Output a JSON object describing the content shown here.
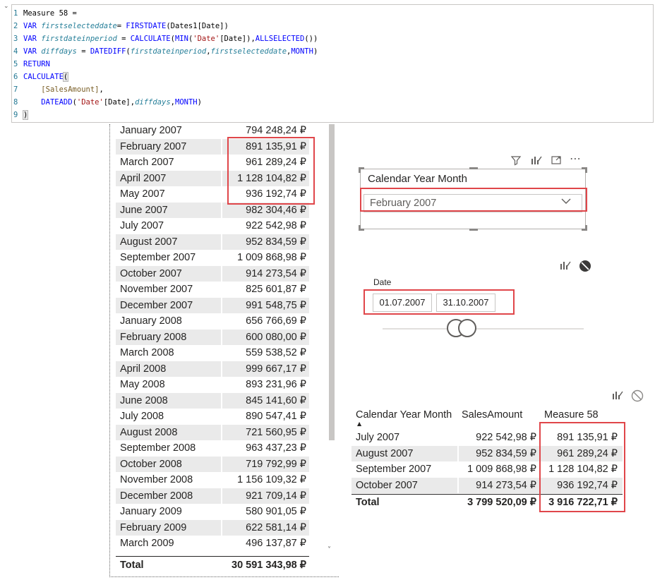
{
  "editor": {
    "line_number_prefix": "1",
    "lines": [
      {
        "num": "1",
        "tokens": [
          {
            "t": "Measure 58 =",
            "c": "plain"
          }
        ]
      },
      {
        "num": "2",
        "tokens": [
          {
            "t": "VAR ",
            "c": "kw"
          },
          {
            "t": "firstselecteddate",
            "c": "var"
          },
          {
            "t": "= ",
            "c": "plain"
          },
          {
            "t": "FIRSTDATE",
            "c": "fn"
          },
          {
            "t": "(Dates1[Date])",
            "c": "plain"
          }
        ]
      },
      {
        "num": "3",
        "tokens": [
          {
            "t": "VAR ",
            "c": "kw"
          },
          {
            "t": "firstdateinperiod",
            "c": "var"
          },
          {
            "t": " = ",
            "c": "plain"
          },
          {
            "t": "CALCULATE",
            "c": "fn"
          },
          {
            "t": "(",
            "c": "plain"
          },
          {
            "t": "MIN",
            "c": "fn"
          },
          {
            "t": "(",
            "c": "plain"
          },
          {
            "t": "'Date'",
            "c": "str"
          },
          {
            "t": "[Date]),",
            "c": "plain"
          },
          {
            "t": "ALLSELECTED",
            "c": "fn"
          },
          {
            "t": "())",
            "c": "plain"
          }
        ]
      },
      {
        "num": "4",
        "tokens": [
          {
            "t": "VAR ",
            "c": "kw"
          },
          {
            "t": "diffdays",
            "c": "var"
          },
          {
            "t": " = ",
            "c": "plain"
          },
          {
            "t": "DATEDIFF",
            "c": "fn"
          },
          {
            "t": "(",
            "c": "plain"
          },
          {
            "t": "firstdateinperiod",
            "c": "var"
          },
          {
            "t": ",",
            "c": "plain"
          },
          {
            "t": "firstselecteddate",
            "c": "var"
          },
          {
            "t": ",",
            "c": "plain"
          },
          {
            "t": "MONTH",
            "c": "kw"
          },
          {
            "t": ")",
            "c": "plain"
          }
        ]
      },
      {
        "num": "5",
        "tokens": [
          {
            "t": "RETURN",
            "c": "kw"
          }
        ]
      },
      {
        "num": "6",
        "tokens": [
          {
            "t": "CALCULATE",
            "c": "fn"
          },
          {
            "t": "(",
            "c": "paren"
          }
        ]
      },
      {
        "num": "7",
        "tokens": [
          {
            "t": "    ",
            "c": "plain"
          },
          {
            "t": "[SalesAmount]",
            "c": "meas"
          },
          {
            "t": ",",
            "c": "plain"
          }
        ]
      },
      {
        "num": "8",
        "tokens": [
          {
            "t": "    ",
            "c": "plain"
          },
          {
            "t": "DATEADD",
            "c": "fn"
          },
          {
            "t": "(",
            "c": "plain"
          },
          {
            "t": "'Date'",
            "c": "str"
          },
          {
            "t": "[Date],",
            "c": "plain"
          },
          {
            "t": "diffdays",
            "c": "var"
          },
          {
            "t": ",",
            "c": "plain"
          },
          {
            "t": "MONTH",
            "c": "kw"
          },
          {
            "t": ")",
            "c": "plain"
          }
        ]
      },
      {
        "num": "9",
        "tokens": [
          {
            "t": ")",
            "c": "paren"
          }
        ]
      }
    ]
  },
  "left_table": {
    "rows": [
      [
        "January 2007",
        "794 248,24 ₽"
      ],
      [
        "February 2007",
        "891 135,91 ₽"
      ],
      [
        "March 2007",
        "961 289,24 ₽"
      ],
      [
        "April 2007",
        "1 128 104,82 ₽"
      ],
      [
        "May 2007",
        "936 192,74 ₽"
      ],
      [
        "June 2007",
        "982 304,46 ₽"
      ],
      [
        "July 2007",
        "922 542,98 ₽"
      ],
      [
        "August 2007",
        "952 834,59 ₽"
      ],
      [
        "September 2007",
        "1 009 868,98 ₽"
      ],
      [
        "October 2007",
        "914 273,54 ₽"
      ],
      [
        "November 2007",
        "825 601,87 ₽"
      ],
      [
        "December 2007",
        "991 548,75 ₽"
      ],
      [
        "January 2008",
        "656 766,69 ₽"
      ],
      [
        "February 2008",
        "600 080,00 ₽"
      ],
      [
        "March 2008",
        "559 538,52 ₽"
      ],
      [
        "April 2008",
        "999 667,17 ₽"
      ],
      [
        "May 2008",
        "893 231,96 ₽"
      ],
      [
        "June 2008",
        "845 141,60 ₽"
      ],
      [
        "July 2008",
        "890 547,41 ₽"
      ],
      [
        "August 2008",
        "721 560,95 ₽"
      ],
      [
        "September 2008",
        "963 437,23 ₽"
      ],
      [
        "October 2008",
        "719 792,99 ₽"
      ],
      [
        "November 2008",
        "1 156 109,32 ₽"
      ],
      [
        "December 2008",
        "921 709,14 ₽"
      ],
      [
        "January 2009",
        "580 901,05 ₽"
      ],
      [
        "February 2009",
        "622 581,14 ₽"
      ],
      [
        "March 2009",
        "496 137,87 ₽"
      ]
    ],
    "total_label": "Total",
    "total_value": "30 591 343,98 ₽"
  },
  "slicer_month": {
    "title": "Calendar Year Month",
    "selected": "February 2007"
  },
  "slicer_date": {
    "label": "Date",
    "start": "01.07.2007",
    "end": "31.10.2007"
  },
  "right_table": {
    "headers": [
      "Calendar Year Month",
      "SalesAmount",
      "Measure 58"
    ],
    "rows": [
      [
        "July 2007",
        "922 542,98 ₽",
        "891 135,91 ₽"
      ],
      [
        "August 2007",
        "952 834,59 ₽",
        "961 289,24 ₽"
      ],
      [
        "September 2007",
        "1 009 868,98 ₽",
        "1 128 104,82 ₽"
      ],
      [
        "October 2007",
        "914 273,54 ₽",
        "936 192,74 ₽"
      ]
    ],
    "total_label": "Total",
    "total_sales": "3 799 520,09 ₽",
    "total_measure": "3 916 722,71 ₽"
  },
  "colors": {
    "highlight_box": "#e0464a",
    "alt_row": "#eaeaea"
  }
}
